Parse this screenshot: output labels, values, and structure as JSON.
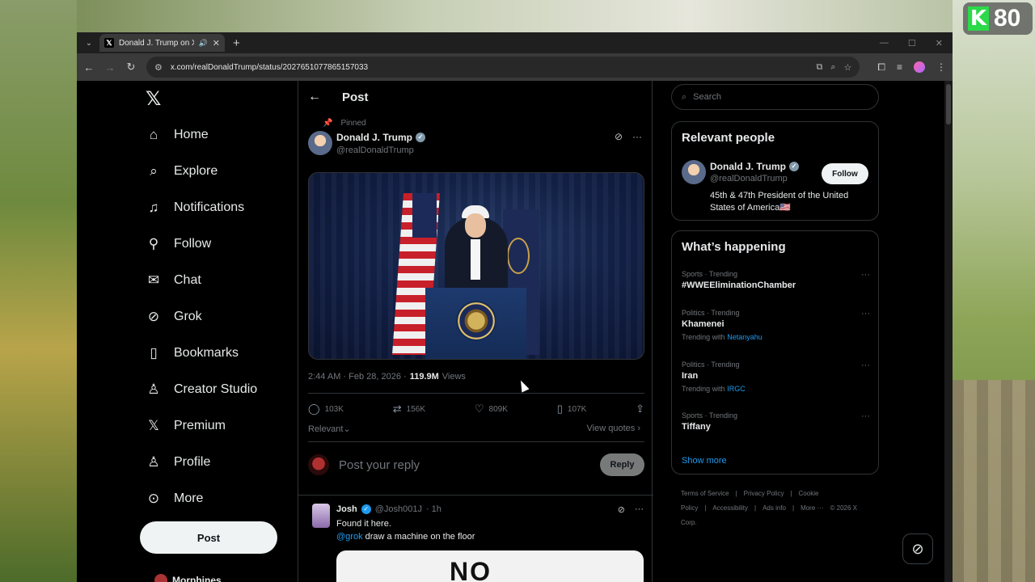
{
  "badge": {
    "score": "80"
  },
  "browser": {
    "tab_title": "Donald J. Trump on X: \"http",
    "url": "x.com/realDonaldTrump/status/2027651077865157033"
  },
  "nav": {
    "items": [
      {
        "label": "Home",
        "icon": "home-icon",
        "glyph": "⌂"
      },
      {
        "label": "Explore",
        "icon": "search-icon",
        "glyph": "⌕"
      },
      {
        "label": "Notifications",
        "icon": "bell-icon",
        "glyph": "♫"
      },
      {
        "label": "Follow",
        "icon": "add-person-icon",
        "glyph": "⚲"
      },
      {
        "label": "Chat",
        "icon": "mail-icon",
        "glyph": "✉"
      },
      {
        "label": "Grok",
        "icon": "grok-icon",
        "glyph": "⊘"
      },
      {
        "label": "Bookmarks",
        "icon": "bookmark-icon",
        "glyph": "▯"
      },
      {
        "label": "Creator Studio",
        "icon": "creator-studio-icon",
        "glyph": "♙"
      },
      {
        "label": "Premium",
        "icon": "x-premium-icon",
        "glyph": "𝕏"
      },
      {
        "label": "Profile",
        "icon": "person-icon",
        "glyph": "♙"
      },
      {
        "label": "More",
        "icon": "more-circle-icon",
        "glyph": "⊙"
      }
    ],
    "post_button": "Post",
    "account_name": "Morphines"
  },
  "post": {
    "header_title": "Post",
    "pinned_label": "Pinned",
    "author_name": "Donald J. Trump",
    "author_handle": "@realDonaldTrump",
    "time": "2:44 AM · Feb 28, 2026 ·",
    "views": "119.9M",
    "views_label": "Views",
    "replies": "103K",
    "reposts": "156K",
    "likes": "809K",
    "bookmarks": "107K",
    "sort_label": "Relevant",
    "view_quotes": "View quotes",
    "reply_placeholder": "Post your reply",
    "reply_button": "Reply"
  },
  "reply_tweet": {
    "name": "Josh",
    "handle": "@Josh001J",
    "time": "· 1h",
    "line1": "Found it here.",
    "mention": "@grok",
    "line2": "draw a machine on the floor",
    "media_text": "NO"
  },
  "right": {
    "search_placeholder": "Search",
    "relevant_title": "Relevant people",
    "person_name": "Donald J. Trump",
    "person_handle": "@realDonaldTrump",
    "follow_label": "Follow",
    "person_bio": "45th & 47th President of the United States of America🇺🇸",
    "happening_title": "What’s happening",
    "trends": [
      {
        "category": "Sports · Trending",
        "topic": "#WWEEliminationChamber",
        "with_label": "",
        "with_link": ""
      },
      {
        "category": "Politics · Trending",
        "topic": "Khamenei",
        "with_label": "Trending with",
        "with_link": "Netanyahu"
      },
      {
        "category": "Politics · Trending",
        "topic": "Iran",
        "with_label": "Trending with",
        "with_link": "IRGC"
      },
      {
        "category": "Sports · Trending",
        "topic": "Tiffany",
        "with_label": "",
        "with_link": ""
      }
    ],
    "show_more": "Show more",
    "footer": [
      "Terms of Service",
      "|",
      "Privacy Policy",
      "|",
      "Cookie Policy",
      "|",
      "Accessibility",
      "|",
      "Ads info",
      "|",
      "More ···",
      "© 2026 X Corp."
    ]
  }
}
